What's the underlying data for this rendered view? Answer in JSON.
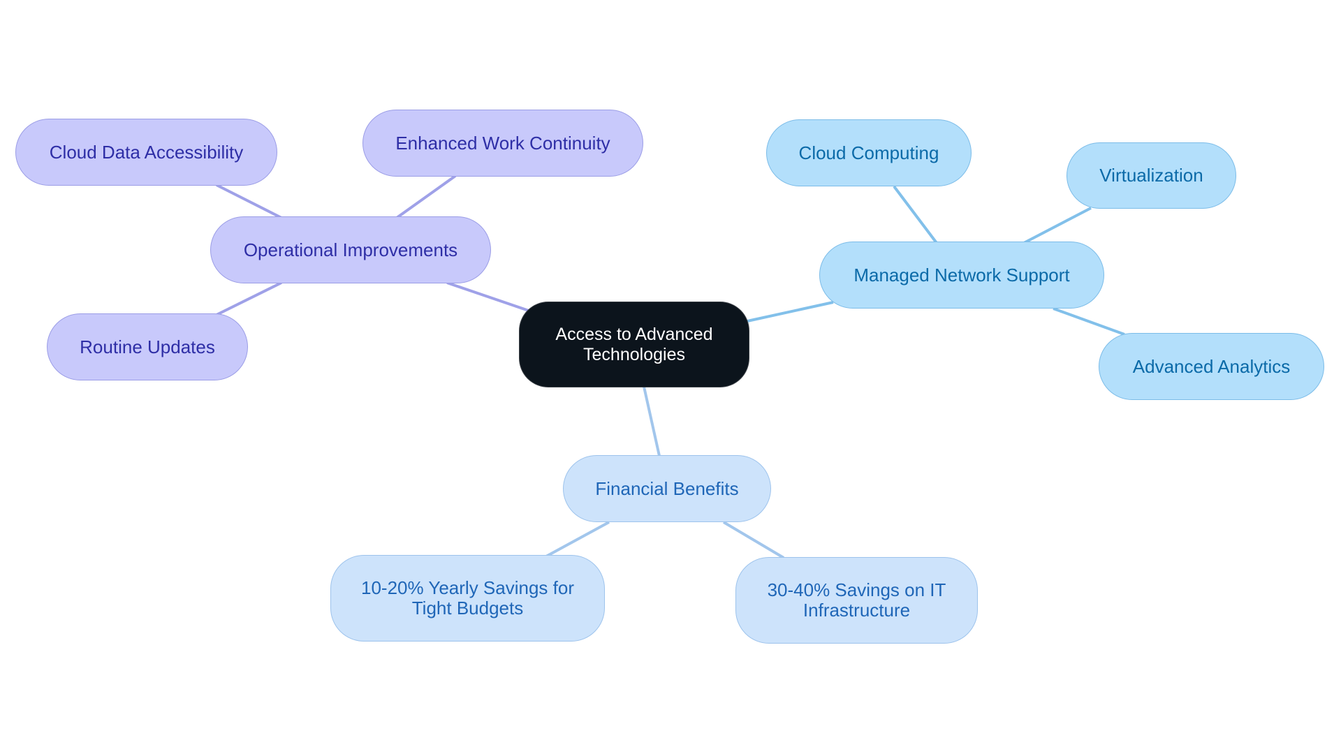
{
  "diagram": {
    "type": "mindmap",
    "root": {
      "id": "root",
      "label": "Access to Advanced Technologies"
    },
    "branches": [
      {
        "id": "ops",
        "label": "Operational Improvements",
        "theme": "purple",
        "children": [
          {
            "id": "cda",
            "label": "Cloud Data Accessibility"
          },
          {
            "id": "ewc",
            "label": "Enhanced Work Continuity"
          },
          {
            "id": "ru",
            "label": "Routine Updates"
          }
        ]
      },
      {
        "id": "mns",
        "label": "Managed Network Support",
        "theme": "blue",
        "children": [
          {
            "id": "cc",
            "label": "Cloud Computing"
          },
          {
            "id": "virt",
            "label": "Virtualization"
          },
          {
            "id": "aa",
            "label": "Advanced Analytics"
          }
        ]
      },
      {
        "id": "fin",
        "label": "Financial Benefits",
        "theme": "lightblue",
        "children": [
          {
            "id": "s1020",
            "label": "10-20% Yearly Savings for Tight Budgets"
          },
          {
            "id": "s3040",
            "label": "30-40% Savings on IT Infrastructure"
          }
        ]
      }
    ],
    "colors": {
      "root_fill": "#0c141c",
      "purple_fill": "#c8c9fb",
      "purple_text": "#2e2ea6",
      "purple_edge": "#9fa1e8",
      "blue_fill": "#b3dffb",
      "blue_text": "#0b6aa8",
      "blue_edge": "#82c0ea",
      "lightblue_fill": "#cde3fb",
      "lightblue_text": "#1f66b7",
      "lightblue_edge": "#a2c6ec"
    }
  }
}
